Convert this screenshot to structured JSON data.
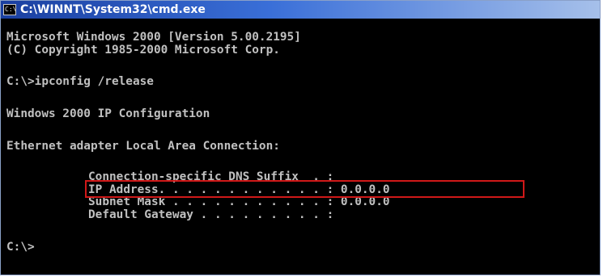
{
  "window": {
    "title": "C:\\WINNT\\System32\\cmd.exe",
    "icon": "console-icon",
    "icon_glyph": "C:\\"
  },
  "console": {
    "lines": [
      "Microsoft Windows 2000 [Version 5.00.2195]",
      "(C) Copyright 1985-2000 Microsoft Corp.",
      "C:\\>ipconfig /release",
      "Windows 2000 IP Configuration",
      "Ethernet adapter Local Area Connection:",
      "Connection-specific DNS Suffix  . :",
      "IP Address. . . . . . . . . . . . : 0.0.0.0",
      "Subnet Mask . . . . . . . . . . . : 0.0.0.0",
      "Default Gateway . . . . . . . . . :",
      "C:\\>"
    ]
  },
  "colors": {
    "console_background": "#000000",
    "console_text": "#c0c0c0",
    "highlight_border": "#d01818",
    "titlebar_start": "#1a3fa0",
    "titlebar_end": "#a6c0ea"
  }
}
